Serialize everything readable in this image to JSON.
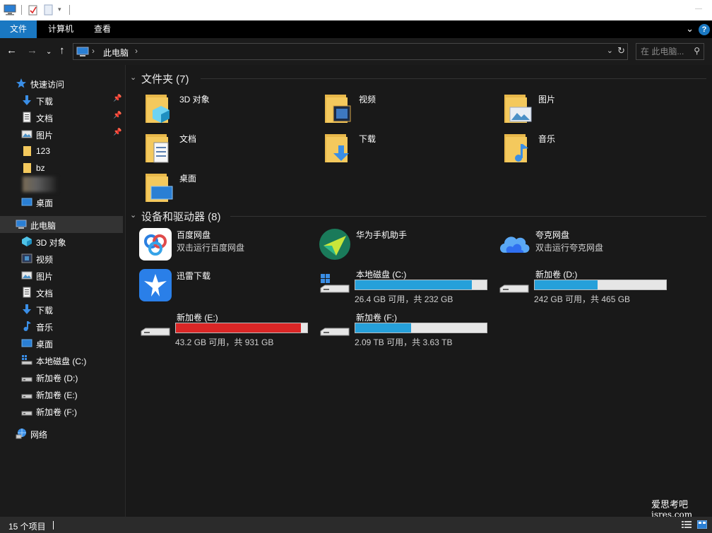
{
  "ribbon": {
    "tabs": [
      {
        "label": "文件",
        "active": true
      },
      {
        "label": "计算机",
        "active": false
      },
      {
        "label": "查看",
        "active": false
      }
    ]
  },
  "address": {
    "crumb": "此电脑",
    "search_placeholder": "在 此电脑..."
  },
  "sidebar": {
    "quick_access": "快速访问",
    "quick_items": [
      {
        "label": "下载",
        "icon": "download-icon"
      },
      {
        "label": "文档",
        "icon": "document-icon"
      },
      {
        "label": "图片",
        "icon": "picture-icon"
      },
      {
        "label": "123",
        "icon": "folder-icon"
      },
      {
        "label": "bz",
        "icon": "folder-icon"
      },
      {
        "label": "桌面",
        "icon": "desktop-icon"
      }
    ],
    "this_pc": "此电脑",
    "pc_items": [
      {
        "label": "3D 对象",
        "icon": "3d-objects-icon"
      },
      {
        "label": "视频",
        "icon": "video-icon"
      },
      {
        "label": "图片",
        "icon": "picture-icon"
      },
      {
        "label": "文档",
        "icon": "document-icon"
      },
      {
        "label": "下载",
        "icon": "download-icon"
      },
      {
        "label": "音乐",
        "icon": "music-icon"
      },
      {
        "label": "桌面",
        "icon": "desktop-icon"
      },
      {
        "label": "本地磁盘 (C:)",
        "icon": "system-drive-icon"
      },
      {
        "label": "新加卷 (D:)",
        "icon": "drive-icon"
      },
      {
        "label": "新加卷 (E:)",
        "icon": "drive-icon"
      },
      {
        "label": "新加卷 (F:)",
        "icon": "drive-icon"
      }
    ],
    "network": "网络"
  },
  "content": {
    "folders_header": "文件夹 (7)",
    "folders": [
      {
        "name": "3D 对象",
        "icon": "3d-objects-folder-icon"
      },
      {
        "name": "视频",
        "icon": "video-folder-icon"
      },
      {
        "name": "图片",
        "icon": "picture-folder-icon"
      },
      {
        "name": "文档",
        "icon": "document-folder-icon"
      },
      {
        "name": "下载",
        "icon": "download-folder-icon"
      },
      {
        "name": "音乐",
        "icon": "music-folder-icon"
      },
      {
        "name": "桌面",
        "icon": "desktop-folder-icon"
      }
    ],
    "devices_header": "设备和驱动器 (8)",
    "apps": [
      {
        "name": "百度网盘",
        "sub": "双击运行百度网盘",
        "icon": "baidu-netdisk-icon"
      },
      {
        "name": "华为手机助手",
        "sub": "",
        "icon": "huawei-hisuite-icon"
      },
      {
        "name": "夸克网盘",
        "sub": "双击运行夸克网盘",
        "icon": "quark-netdisk-icon"
      },
      {
        "name": "迅雷下载",
        "sub": "",
        "icon": "thunder-download-icon"
      }
    ],
    "drives": [
      {
        "name": "本地磁盘 (C:)",
        "free": "26.4 GB 可用，共 232 GB",
        "used_fraction": 0.886,
        "color": "#26a0da",
        "icon": "system-drive-icon"
      },
      {
        "name": "新加卷 (D:)",
        "free": "242 GB 可用，共 465 GB",
        "used_fraction": 0.48,
        "color": "#26a0da",
        "icon": "drive-icon"
      },
      {
        "name": "新加卷 (E:)",
        "free": "43.2 GB 可用，共 931 GB",
        "used_fraction": 0.954,
        "color": "#da2626",
        "icon": "drive-icon"
      },
      {
        "name": "新加卷 (F:)",
        "free": "2.09 TB 可用，共 3.63 TB",
        "used_fraction": 0.424,
        "color": "#26a0da",
        "icon": "drive-icon"
      }
    ]
  },
  "status": {
    "count": "15 个项目"
  },
  "watermark": {
    "line1": "爱思考吧",
    "line2": "isres.com"
  },
  "colors": {
    "accent": "#1a78c2",
    "bar_normal": "#26a0da",
    "bar_full": "#da2626",
    "folder": "#f4c95d"
  }
}
